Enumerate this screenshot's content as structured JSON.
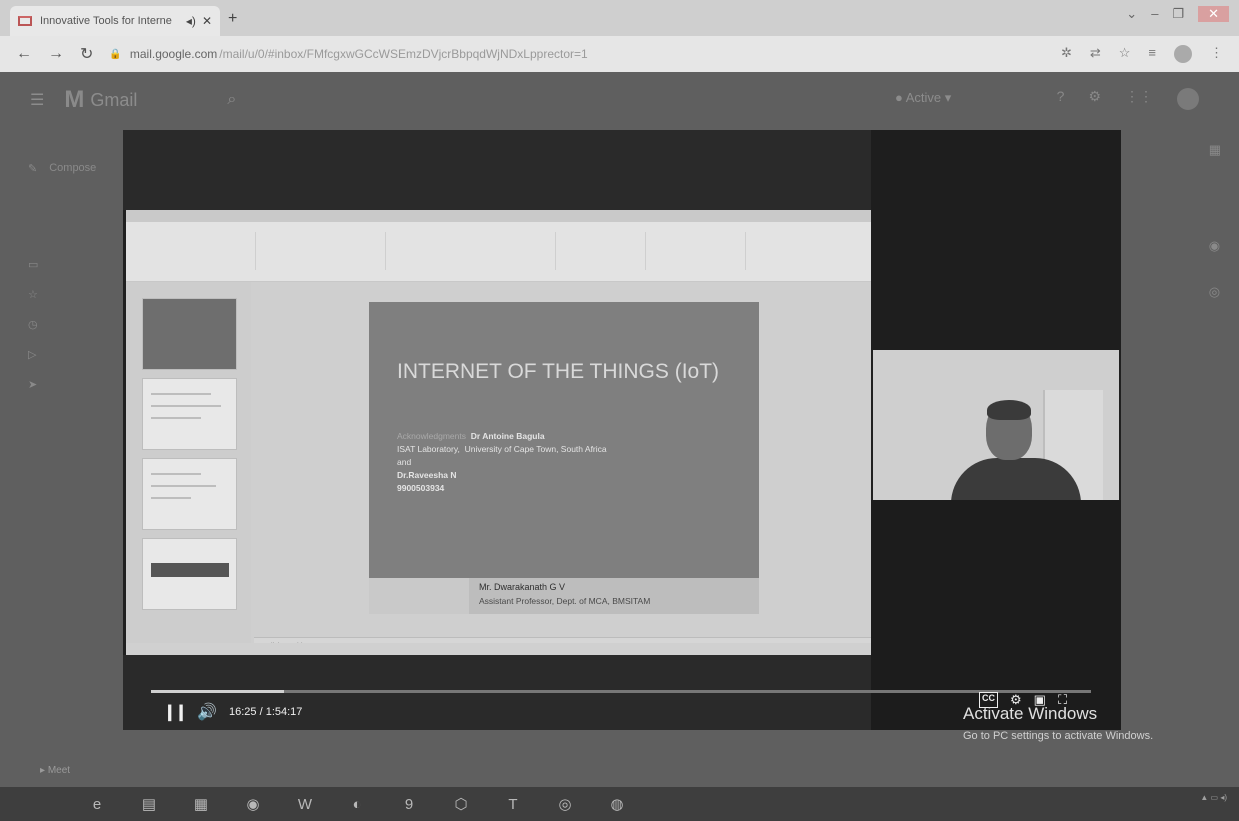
{
  "browser": {
    "tab_title": "Innovative Tools for Interne",
    "url": "mail.google.com",
    "url_path": "/mail/u/0/#inbox/FMfcgxwGCcWSEmzDVjcrBbpqdWjNDxLpprector=1"
  },
  "gmail": {
    "app_name": "Gmail",
    "compose": "Compose",
    "status": "Active"
  },
  "slide": {
    "title": "INTERNET OF THE THINGS (IoT)",
    "ack_label": "Acknowledgments",
    "ack_name": "Dr Antoine Bagula",
    "lab": "ISAT Laboratory,",
    "university": "University of Cape Town, South Africa",
    "and": "and",
    "second_name": "Dr.Raveesha N",
    "phone": "9900503934",
    "presenter_name": "Mr. Dwarakanath G V",
    "presenter_title": "Assistant Professor, Dept. of MCA, BMSITAM",
    "notes_placeholder": "Click to add notes"
  },
  "player": {
    "time": "16:25 / 1:54:17",
    "progress": 0.142,
    "cc": "CC"
  },
  "watermark": {
    "line1": "Activate Windows",
    "line2": "Go to PC settings to activate Windows."
  },
  "meet": "Meet",
  "colors": {
    "player_bg": "#202020",
    "slide_bg": "#7f7f7f",
    "taskbar": "#3e3e3e"
  }
}
